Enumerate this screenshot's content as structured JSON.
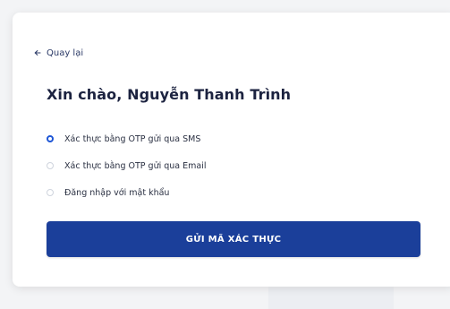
{
  "back": {
    "label": "Quay lại"
  },
  "greeting": "Xin chào, Nguyễn Thanh Trình",
  "options": [
    {
      "label": "Xác thực bằng OTP gửi qua SMS",
      "selected": true
    },
    {
      "label": "Xác thực bằng OTP gửi qua Email",
      "selected": false
    },
    {
      "label": "Đăng nhập với mật khẩu",
      "selected": false
    }
  ],
  "submit": {
    "label": "GỬI MÃ XÁC THỰC"
  },
  "icons": {
    "back": "arrow-left-icon"
  },
  "colors": {
    "primary": "#1b3f9a",
    "radio_selected": "#1e56d6",
    "title": "#1c2340",
    "background": "#f3f4f6",
    "card": "#ffffff"
  }
}
